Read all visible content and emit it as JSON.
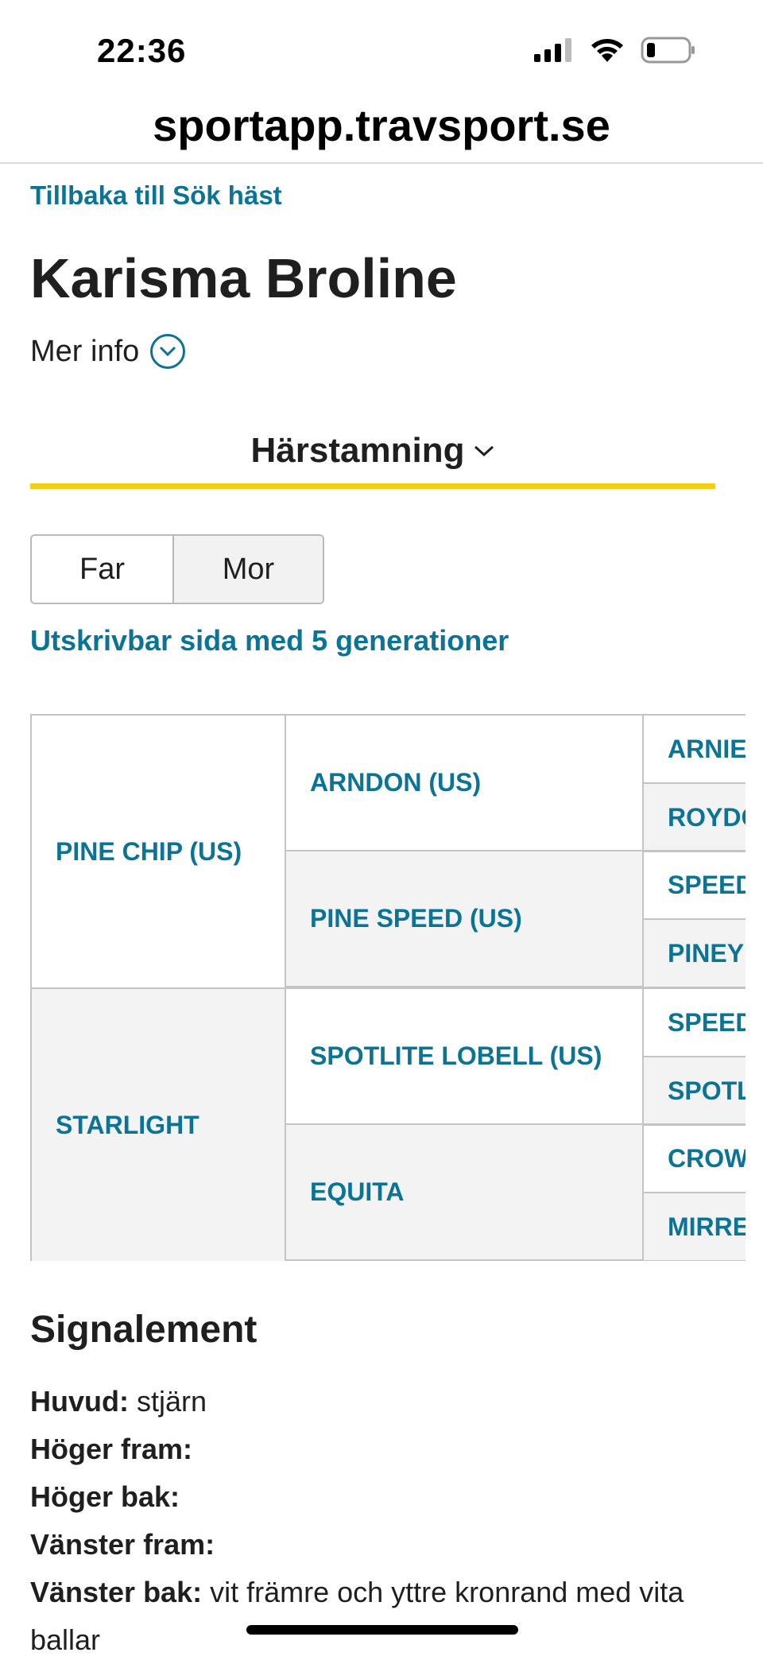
{
  "status_bar": {
    "time": "22:36"
  },
  "browser": {
    "url": "sportapp.travsport.se"
  },
  "nav": {
    "back_label": "Tillbaka till Sök häst"
  },
  "horse": {
    "name": "Karisma Broline",
    "more_info_label": "Mer info"
  },
  "section": {
    "label": "Härstamning"
  },
  "toggle": {
    "options": [
      "Far",
      "Mor"
    ],
    "selected": "Mor"
  },
  "print_link": "Utskrivbar sida med 5 generationer",
  "pedigree": {
    "gen1": [
      "PINE CHIP (US)",
      "STARLIGHT"
    ],
    "gen2": [
      "ARNDON (US)",
      "PINE SPEED (US)",
      "SPOTLITE LOBELL (US)",
      "EQUITA"
    ],
    "gen3": [
      "ARNIE",
      "ROYDC",
      "SPEED",
      "PINEY",
      "SPEED",
      "SPOTL",
      "CROW",
      "MIRRE"
    ]
  },
  "signalement": {
    "title": "Signalement",
    "rows": [
      {
        "label": "Huvud:",
        "value": "stjärn"
      },
      {
        "label": "Höger fram:",
        "value": ""
      },
      {
        "label": "Höger bak:",
        "value": ""
      },
      {
        "label": "Vänster fram:",
        "value": ""
      },
      {
        "label": "Vänster bak:",
        "value": "vit främre och yttre kronrand med vita ballar"
      }
    ]
  },
  "colors": {
    "link": "#0a7396",
    "accent": "#f2cf14",
    "shade": "#f3f3f3"
  }
}
